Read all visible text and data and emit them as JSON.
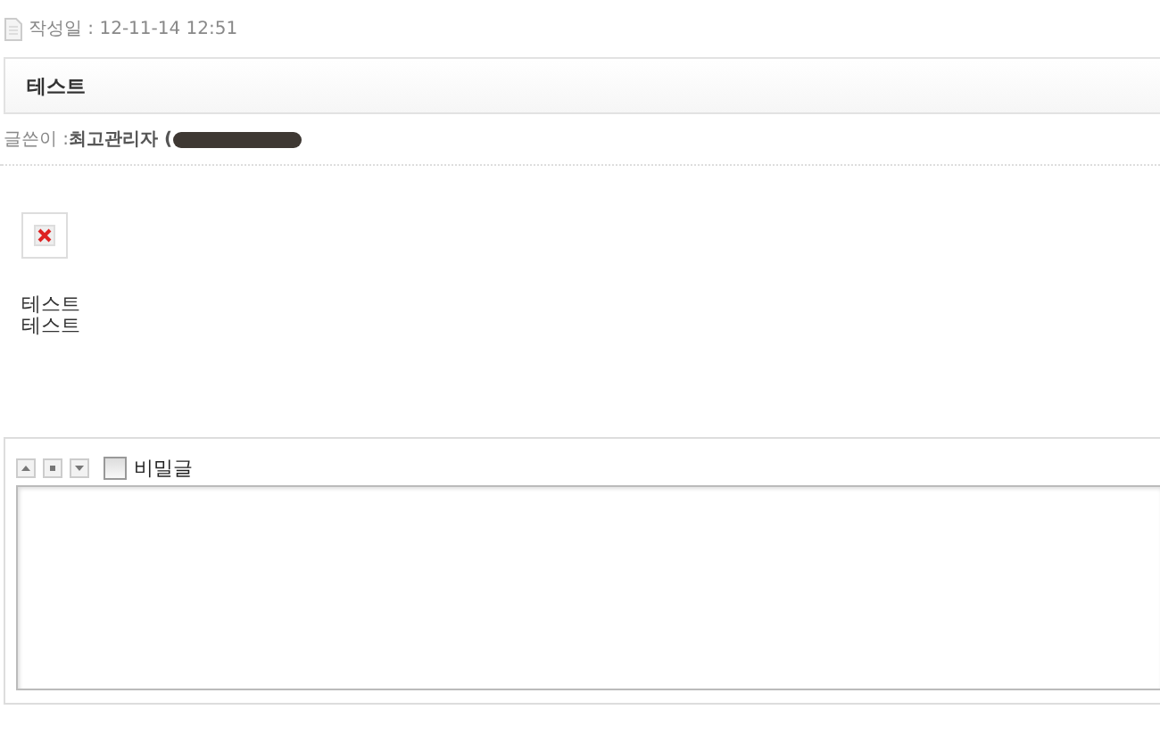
{
  "post": {
    "date_label": "작성일 : 12-11-14 12:51",
    "title": "테스트",
    "author_label": "글쓴이 : ",
    "author_name": "최고관리자 (",
    "body_lines": [
      "테스트",
      "테스트"
    ]
  },
  "comment": {
    "secret": {
      "label": "비밀글",
      "checked": false
    }
  }
}
